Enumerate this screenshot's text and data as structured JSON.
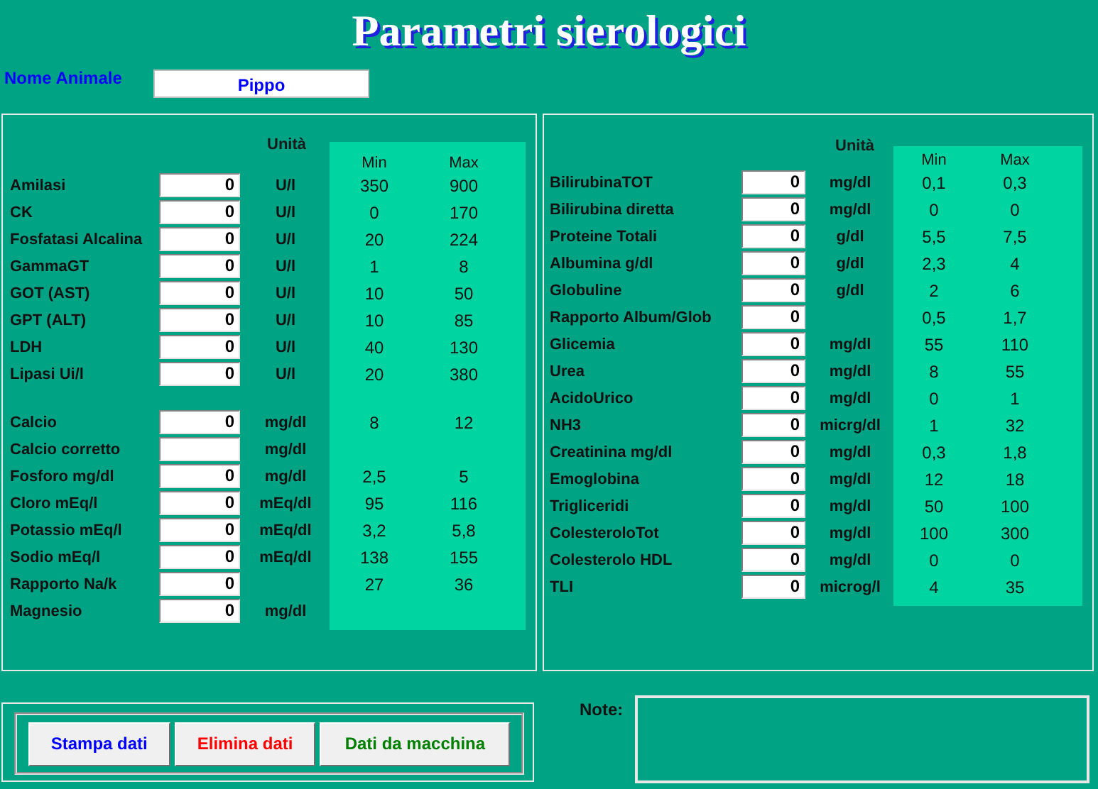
{
  "title": "Parametri sierologici",
  "animal": {
    "label": "Nome Animale",
    "value": "Pippo"
  },
  "left_panel": {
    "unit_header": "Unità",
    "min_header": "Min",
    "max_header": "Max",
    "groups": [
      {
        "rows": [
          {
            "name": "Amilasi",
            "value": "0",
            "unit": "U/l",
            "min": "350",
            "max": "900"
          },
          {
            "name": "CK",
            "value": "0",
            "unit": "U/l",
            "min": "0",
            "max": "170"
          },
          {
            "name": "Fosfatasi Alcalina",
            "value": "0",
            "unit": "U/l",
            "min": "20",
            "max": "224"
          },
          {
            "name": "GammaGT",
            "value": "0",
            "unit": "U/l",
            "min": "1",
            "max": "8"
          },
          {
            "name": "GOT (AST)",
            "value": "0",
            "unit": "U/l",
            "min": "10",
            "max": "50"
          },
          {
            "name": "GPT (ALT)",
            "value": "0",
            "unit": "U/l",
            "min": "10",
            "max": "85"
          },
          {
            "name": "LDH",
            "value": "0",
            "unit": "U/l",
            "min": "40",
            "max": "130"
          },
          {
            "name": "Lipasi Ui/l",
            "value": "0",
            "unit": "U/l",
            "min": "20",
            "max": "380"
          }
        ]
      },
      {
        "rows": [
          {
            "name": "Calcio",
            "value": "0",
            "unit": "mg/dl",
            "min": "8",
            "max": "12"
          },
          {
            "name": "Calcio corretto",
            "unit": "mg/dl"
          },
          {
            "name": "Fosforo mg/dl",
            "value": "0",
            "unit": "mg/dl",
            "min": "2,5",
            "max": "5"
          },
          {
            "name": "Cloro mEq/l",
            "value": "0",
            "unit": "mEq/dl",
            "min": "95",
            "max": "116"
          },
          {
            "name": "Potassio mEq/l",
            "value": "0",
            "unit": "mEq/dl",
            "min": "3,2",
            "max": "5,8"
          },
          {
            "name": "Sodio mEq/l",
            "value": "0",
            "unit": "mEq/dl",
            "min": "138",
            "max": "155"
          },
          {
            "name": "Rapporto Na/k",
            "value": "0",
            "min": "27",
            "max": "36"
          },
          {
            "name": "Magnesio",
            "value": "0",
            "unit": "mg/dl"
          }
        ]
      }
    ]
  },
  "right_panel": {
    "unit_header": "Unità",
    "min_header": "Min",
    "max_header": "Max",
    "groups": [
      {
        "rows": [
          {
            "name": "BilirubinaTOT",
            "value": "0",
            "unit": "mg/dl",
            "min": "0,1",
            "max": "0,3"
          },
          {
            "name": "Bilirubina diretta",
            "value": "0",
            "unit": "mg/dl",
            "min": "0",
            "max": "0"
          },
          {
            "name": "Proteine Totali",
            "value": "0",
            "unit": "g/dl",
            "min": "5,5",
            "max": "7,5"
          },
          {
            "name": "Albumina g/dl",
            "value": "0",
            "unit": "g/dl",
            "min": "2,3",
            "max": "4"
          },
          {
            "name": "Globuline",
            "value": "0",
            "unit": "g/dl",
            "min": "2",
            "max": "6"
          },
          {
            "name": "Rapporto Album/Glob",
            "value": "0",
            "min": "0,5",
            "max": "1,7"
          },
          {
            "name": "Glicemia",
            "value": "0",
            "unit": "mg/dl",
            "min": "55",
            "max": "110"
          },
          {
            "name": "Urea",
            "value": "0",
            "unit": "mg/dl",
            "min": "8",
            "max": "55"
          },
          {
            "name": "AcidoUrico",
            "value": "0",
            "unit": "mg/dl",
            "min": "0",
            "max": "1"
          },
          {
            "name": "NH3",
            "value": "0",
            "unit": "micrg/dl",
            "min": "1",
            "max": "32"
          },
          {
            "name": "Creatinina mg/dl",
            "value": "0",
            "unit": "mg/dl",
            "min": "0,3",
            "max": "1,8"
          },
          {
            "name": "Emoglobina",
            "value": "0",
            "unit": "mg/dl",
            "min": "12",
            "max": "18"
          },
          {
            "name": "Trigliceridi",
            "value": "0",
            "unit": "mg/dl",
            "min": "50",
            "max": "100"
          },
          {
            "name": "ColesteroloTot",
            "value": "0",
            "unit": "mg/dl",
            "min": "100",
            "max": "300"
          },
          {
            "name": "Colesterolo HDL",
            "value": "0",
            "unit": "mg/dl",
            "min": "0",
            "max": "0"
          },
          {
            "name": "TLI",
            "value": "0",
            "unit": "microg/l",
            "min": "4",
            "max": "35"
          }
        ]
      }
    ]
  },
  "buttons": [
    {
      "label": "Stampa dati",
      "color": "#0000ff"
    },
    {
      "label": "Elimina dati",
      "color": "#ff0000"
    },
    {
      "label": "Dati da macchina",
      "color": "#008000"
    }
  ],
  "note": {
    "label": "Note:"
  }
}
